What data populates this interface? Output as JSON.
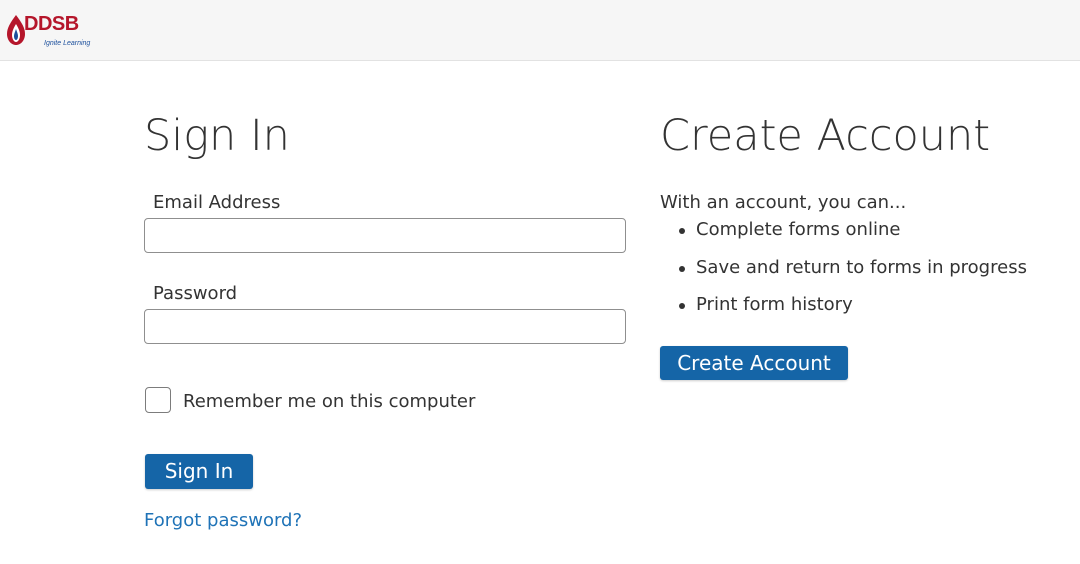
{
  "brand": {
    "name": "DDSB",
    "tagline": "Ignite Learning",
    "primary_color": "#1565a7",
    "logo_red": "#b5162b",
    "logo_blue": "#1b4f9c"
  },
  "signin": {
    "heading": "Sign In",
    "email_label": "Email Address",
    "email_value": "",
    "password_label": "Password",
    "password_value": "",
    "remember_label": "Remember me on this computer",
    "remember_checked": false,
    "button_label": "Sign In",
    "forgot_link": "Forgot password?"
  },
  "create": {
    "heading": "Create Account",
    "intro": "With an account, you can...",
    "benefits": [
      "Complete forms online",
      "Save and return to forms in progress",
      "Print form history"
    ],
    "button_label": "Create Account"
  }
}
